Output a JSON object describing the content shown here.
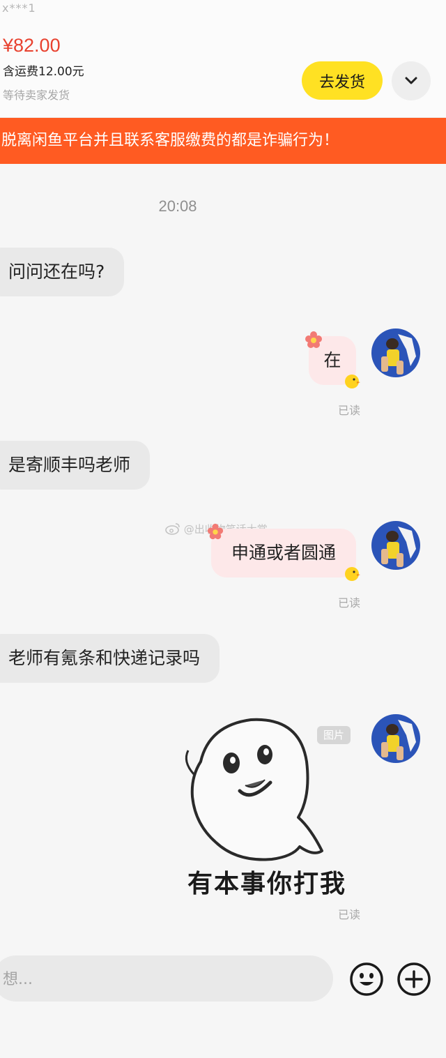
{
  "header": {
    "buyer_name": "x***1",
    "price": "¥82.00",
    "shipping_fee": "含运费12.00元",
    "order_status": "等待卖家发货",
    "ship_button": "去发货"
  },
  "warning_banner": "脱离闲鱼平台并且联系客服缴费的都是诈骗行为！",
  "chat": {
    "timestamp": "20:08",
    "messages": [
      {
        "from": "buyer",
        "text": "问问还在吗?"
      },
      {
        "from": "seller",
        "text": "在",
        "status": "已读"
      },
      {
        "from": "buyer",
        "text": "是寄顺丰吗老师"
      },
      {
        "from": "seller",
        "text": "申通或者圆通",
        "status": "已读"
      },
      {
        "from": "buyer",
        "text": "老师有氪条和快递记录吗"
      },
      {
        "from": "seller",
        "type": "image",
        "tag": "图片",
        "sticker_caption": "有本事你打我",
        "status": "已读"
      }
    ]
  },
  "watermark": "@出收物笑话大赏",
  "input": {
    "placeholder": "想..."
  },
  "icons": [
    "chevron-down-icon",
    "emoji-icon",
    "plus-icon",
    "flower-icon",
    "chick-icon",
    "weibo-icon"
  ],
  "colors": {
    "price": "#e8412e",
    "ship_button": "#ffe123",
    "banner": "#ff5b22",
    "outgoing_bubble": "#fde8e9",
    "incoming_bubble": "#e9e9e9"
  }
}
